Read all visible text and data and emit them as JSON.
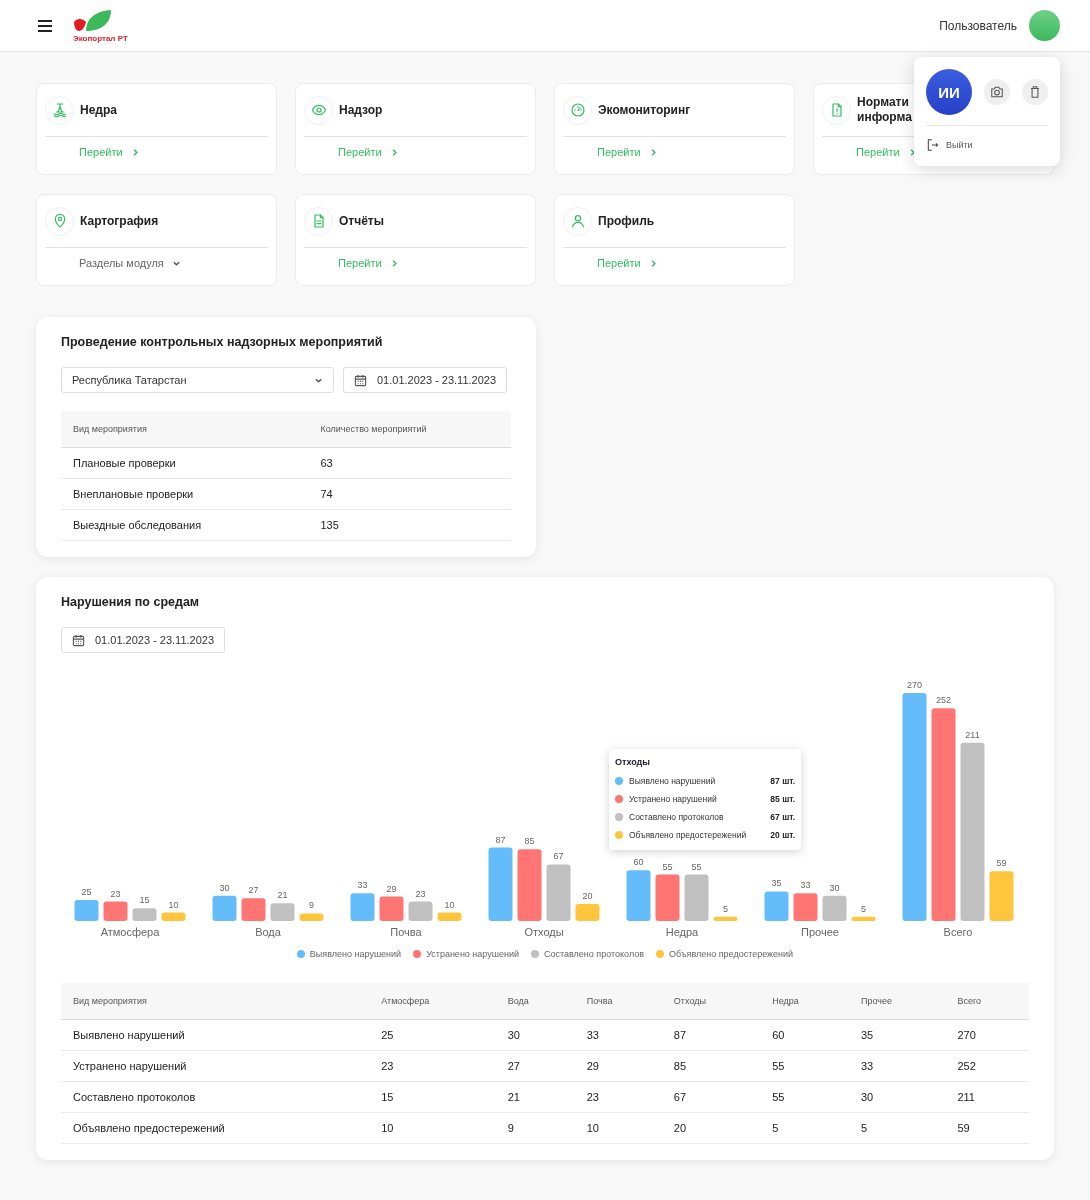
{
  "header": {
    "logo_text": "Экопортал РТ",
    "user_name": "Пользователь"
  },
  "modules": [
    {
      "kind": "link",
      "title": [
        "Недра"
      ],
      "action": "Перейти"
    },
    {
      "kind": "link",
      "title": [
        "Надзор"
      ],
      "action": "Перейти"
    },
    {
      "kind": "link",
      "title": [
        "Экомониторинг"
      ],
      "action": "Перейти"
    },
    {
      "kind": "link",
      "title": [
        "Нормати",
        "информа"
      ],
      "action": "Перейти"
    },
    {
      "kind": "dropdown",
      "title": [
        "Картография"
      ],
      "action": "Разделы модуля"
    },
    {
      "kind": "link",
      "title": [
        "Отчёты"
      ],
      "action": "Перейти"
    },
    {
      "kind": "link",
      "title": [
        "Профиль"
      ],
      "action": "Перейти"
    }
  ],
  "user_menu": {
    "initials": "ИИ",
    "logout": "Выйти"
  },
  "inspections": {
    "title": "Проведение контрольных надзорных мероприятий",
    "region": "Республика Татарстан",
    "period": "01.01.2023 - 23.11.2023",
    "columns": [
      "Вид мероприятия",
      "Количество мероприятий"
    ],
    "rows": [
      [
        "Плановые проверки",
        "63"
      ],
      [
        "Внеплановые проверки",
        "74"
      ],
      [
        "Выездные обследования",
        "135"
      ]
    ]
  },
  "violations": {
    "title": "Нарушения по средам",
    "period": "01.01.2023 - 23.11.2023",
    "chart_data": {
      "type": "bar",
      "legend": "bottom",
      "categories": [
        "Атмосфера",
        "Вода",
        "Почва",
        "Отходы",
        "Недра",
        "Прочее",
        "Всего"
      ],
      "data_labels": true,
      "series": [
        {
          "name": "Выявлено нарушений",
          "color": "#64bcfb",
          "values": [
            25,
            30,
            33,
            87,
            60,
            35,
            270
          ]
        },
        {
          "name": "Устранено нарушений",
          "color": "#fe7573",
          "values": [
            23,
            27,
            29,
            85,
            55,
            33,
            252
          ]
        },
        {
          "name": "Составлено протоколов",
          "color": "#c0c0c0",
          "values": [
            15,
            21,
            23,
            67,
            55,
            30,
            211
          ]
        },
        {
          "name": "Объявлено предостережений",
          "color": "#fec53d",
          "values": [
            10,
            9,
            10,
            20,
            5,
            5,
            59
          ]
        }
      ]
    },
    "tooltip": {
      "title": "Отходы",
      "items": [
        {
          "label": "Выявлено нарушений",
          "value": "87 шт.",
          "color": "#64bcfb"
        },
        {
          "label": "Устранено нарушений",
          "value": "85 шт.",
          "color": "#fe7573"
        },
        {
          "label": "Составлено протоколов",
          "value": "67 шт.",
          "color": "#c0c0c0"
        },
        {
          "label": "Объявлено предостережений",
          "value": "20 шт.",
          "color": "#fec53d"
        }
      ]
    },
    "columns": [
      "Вид мероприятия",
      "Атмосфера",
      "Вода",
      "Почва",
      "Отходы",
      "Недра",
      "Прочее",
      "Всего"
    ],
    "rows": [
      [
        "Выявлено нарушений",
        "25",
        "30",
        "33",
        "87",
        "60",
        "35",
        "270"
      ],
      [
        "Устранено нарушений",
        "23",
        "27",
        "29",
        "85",
        "55",
        "33",
        "252"
      ],
      [
        "Составлено протоколов",
        "15",
        "21",
        "23",
        "67",
        "55",
        "30",
        "211"
      ],
      [
        "Объявлено предостережений",
        "10",
        "9",
        "10",
        "20",
        "5",
        "5",
        "59"
      ]
    ]
  }
}
